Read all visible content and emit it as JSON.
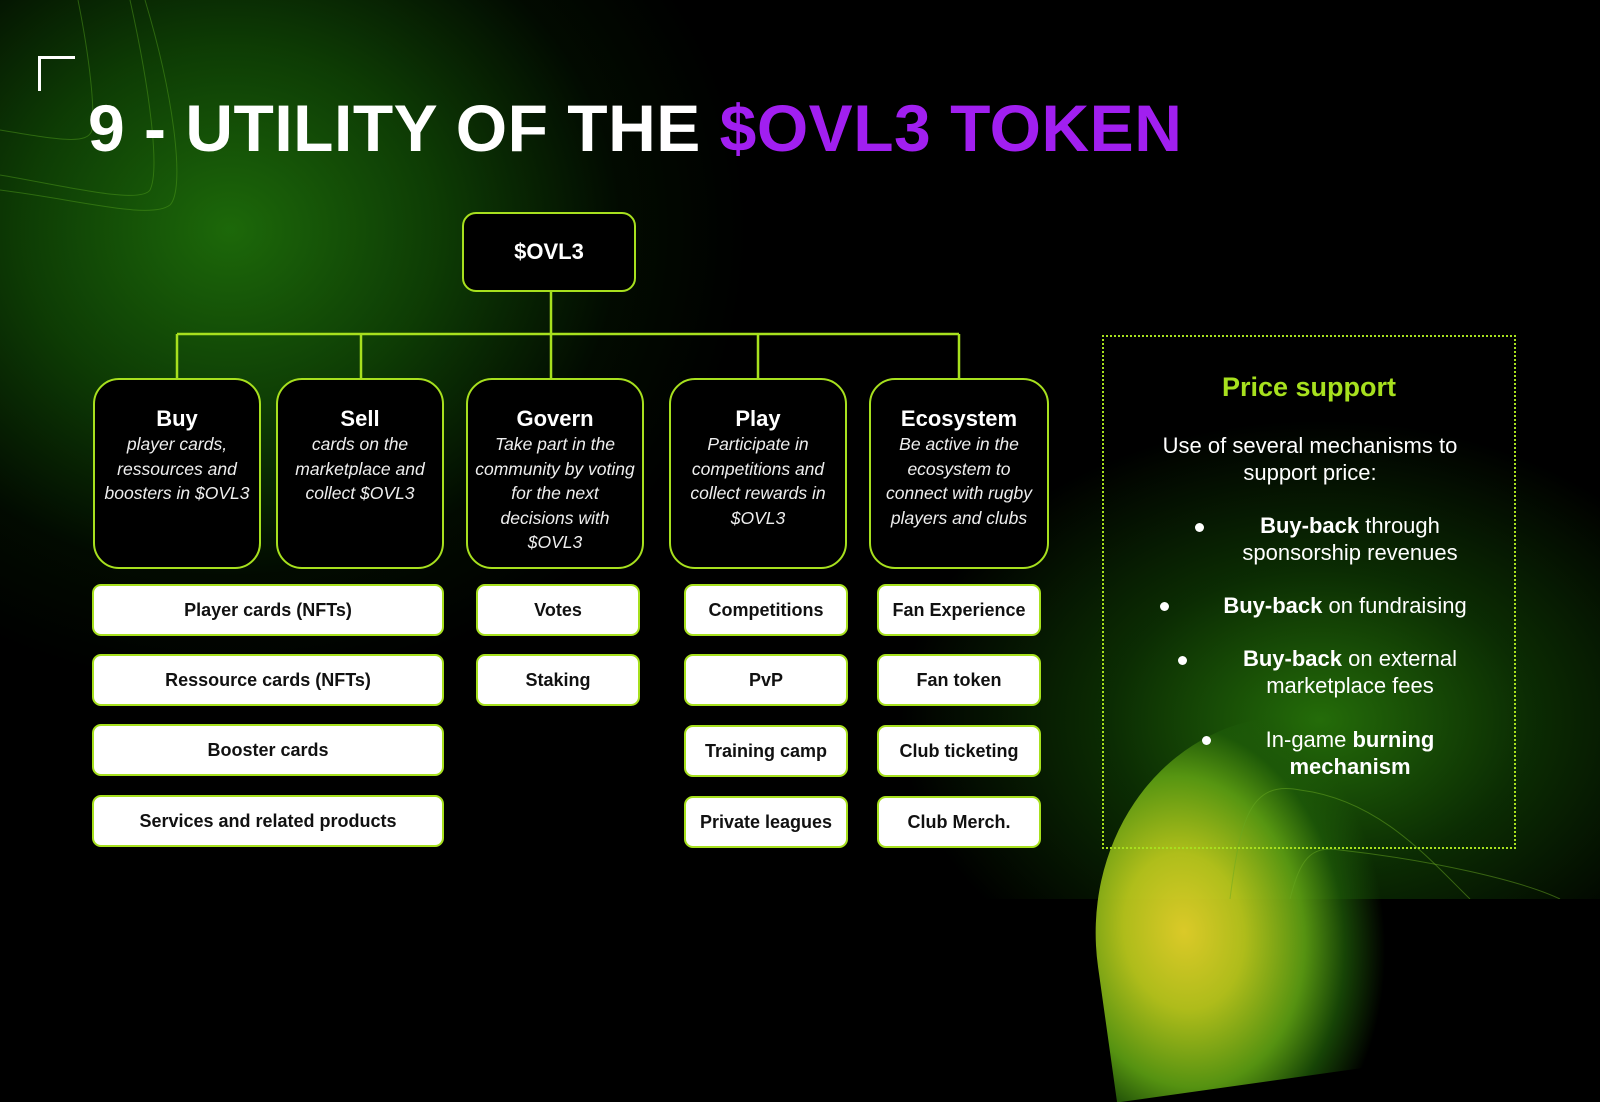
{
  "slide": {
    "title_prefix": "9 - UTILITY OF THE",
    "title_accent": "$OVL3 TOKEN",
    "accent_color": "#a11ff0",
    "line_color": "#a7e01e"
  },
  "tree": {
    "root": "$OVL3",
    "categories": [
      {
        "heading": "Buy",
        "description": "player cards, ressources and boosters in $OVL3"
      },
      {
        "heading": "Sell",
        "description": "cards on the marketplace and collect $OVL3"
      },
      {
        "heading": "Govern",
        "description": "Take part in the community by voting for the next decisions with $OVL3"
      },
      {
        "heading": "Play",
        "description": "Participate in competitions and collect rewards in $OVL3"
      },
      {
        "heading": "Ecosystem",
        "description": "Be active in the ecosystem to connect with rugby players and clubs"
      }
    ],
    "buy_sell_items": [
      "Player cards (NFTs)",
      "Ressource cards (NFTs)",
      "Booster cards",
      "Services and related products"
    ],
    "govern_items": [
      "Votes",
      "Staking"
    ],
    "play_items": [
      "Competitions",
      "PvP",
      "Training camp",
      "Private leagues"
    ],
    "ecosystem_items": [
      "Fan Experience",
      "Fan token",
      "Club ticketing",
      "Club Merch."
    ]
  },
  "price_support": {
    "title": "Price support",
    "intro": "Use of several mechanisms to support price:",
    "bullets": [
      {
        "bold": "Buy-back",
        "rest": " through sponsorship revenues"
      },
      {
        "bold": "Buy-back",
        "rest": " on fundraising"
      },
      {
        "bold": "Buy-back",
        "rest": " on external marketplace fees"
      },
      {
        "pre": "In-game ",
        "bold": "burning mechanism"
      }
    ]
  }
}
